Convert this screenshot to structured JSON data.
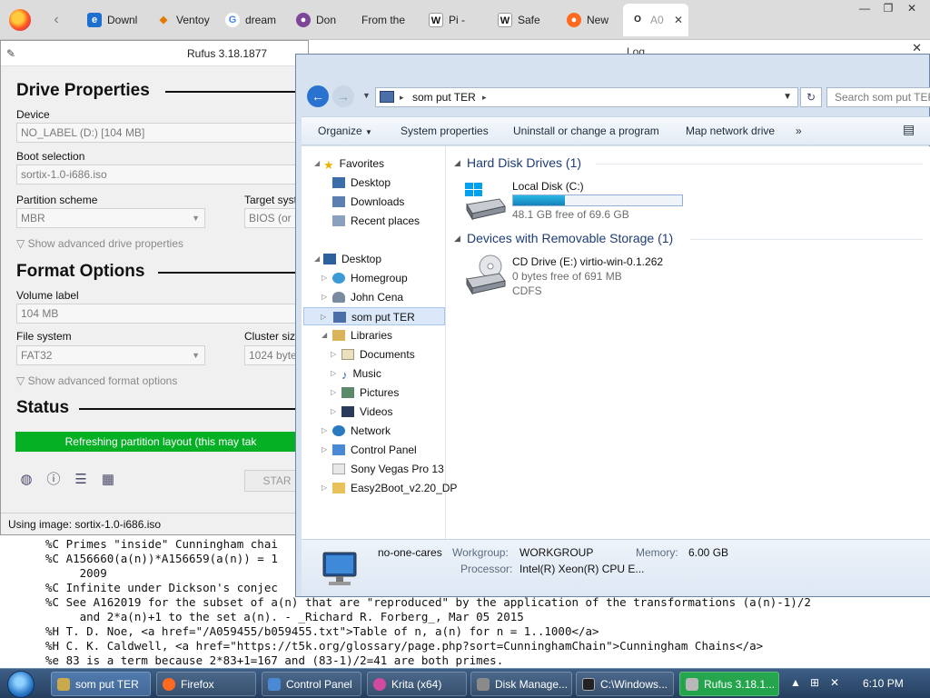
{
  "browser": {
    "tabs": [
      {
        "label": "Downl",
        "icon": "edge-icon"
      },
      {
        "label": "Ventoy",
        "icon": "ventoy-icon"
      },
      {
        "label": "dream",
        "icon": "google-icon"
      },
      {
        "label": "Don",
        "icon": "tor-icon"
      },
      {
        "label": "From the",
        "icon": "blank-icon"
      },
      {
        "label": "Pi -",
        "icon": "wikipedia-icon"
      },
      {
        "label": "Safe",
        "icon": "wikipedia-icon"
      },
      {
        "label": "New",
        "icon": "firefox-icon"
      },
      {
        "label": "A0",
        "icon": "oeis-icon",
        "active": true
      }
    ]
  },
  "rufus": {
    "title": "Rufus 3.18.1877",
    "drive_properties_title": "Drive Properties",
    "device_label": "Device",
    "device_value": "NO_LABEL (D:) [104 MB]",
    "boot_selection_label": "Boot selection",
    "boot_selection_value": "sortix-1.0-i686.iso",
    "partition_scheme_label": "Partition scheme",
    "partition_scheme_value": "MBR",
    "target_system_label": "Target syst",
    "target_system_value": "BIOS (or U",
    "show_advanced_drive": "Show advanced drive properties",
    "format_options_title": "Format Options",
    "volume_label_label": "Volume label",
    "volume_label_value": "104 MB",
    "file_system_label": "File system",
    "file_system_value": "FAT32",
    "cluster_size_label": "Cluster size",
    "cluster_size_value": "1024 bytes",
    "show_advanced_format": "Show advanced format options",
    "status_title": "Status",
    "progress_text": "Refreshing partition layout (this may tak",
    "start_label": "STAR",
    "status_bar": "Using image: sortix-1.0-i686.iso"
  },
  "log_title": "Log",
  "explorer": {
    "address_crumb": "som put TER",
    "search_placeholder": "Search som put TER",
    "toolbar": {
      "organize": "Organize",
      "system_properties": "System properties",
      "uninstall": "Uninstall or change a program",
      "map_drive": "Map network drive",
      "more": "»"
    },
    "nav": {
      "favorites": "Favorites",
      "desktop_fav": "Desktop",
      "downloads": "Downloads",
      "recent_places": "Recent places",
      "desktop": "Desktop",
      "homegroup": "Homegroup",
      "john_cena": "John Cena",
      "som_put_ter": "som put TER",
      "libraries": "Libraries",
      "documents": "Documents",
      "music": "Music",
      "pictures": "Pictures",
      "videos": "Videos",
      "network": "Network",
      "control_panel": "Control Panel",
      "sony_vegas": "Sony Vegas Pro 13",
      "easy2boot": "Easy2Boot_v2.20_DP"
    },
    "hard_disk_header": "Hard Disk Drives (1)",
    "local_disk_name": "Local Disk (C:)",
    "local_disk_free": "48.1 GB free of 69.6 GB",
    "local_disk_used_fraction": 0.309,
    "removable_header": "Devices with Removable Storage (1)",
    "cd_name": "CD Drive (E:) virtio-win-0.1.262",
    "cd_free": "0 bytes free of 691 MB",
    "cd_fs": "CDFS",
    "details": {
      "computer_name": "no-one-cares",
      "workgroup_label": "Workgroup:",
      "workgroup_value": "WORKGROUP",
      "memory_label": "Memory:",
      "memory_value": "6.00 GB",
      "processor_label": "Processor:",
      "processor_value": "Intel(R) Xeon(R) CPU E..."
    }
  },
  "oeis_lines": [
    "%C Primes \"inside\" Cunningham chai",
    "%C A156660(a(n))*A156659(a(n)) = 1",
    "     2009",
    "%C Infinite under Dickson's conjec",
    "%C See A162019 for the subset of a(n) that are \"reproduced\" by the application of the transformations (a(n)-1)/2",
    "     and 2*a(n)+1 to the set a(n). - _Richard R. Forberg_, Mar 05 2015",
    "%H T. D. Noe, <a href=\"/A059455/b059455.txt\">Table of n, a(n) for n = 1..1000</a>",
    "%H C. K. Caldwell, <a href=\"https://t5k.org/glossary/page.php?sort=CunninghamChain\">Cunningham Chains</a>",
    "%e 83 is a term because 2*83+1=167 and (83-1)/2=41 are both primes."
  ],
  "taskbar": {
    "items": [
      {
        "label": "som put TER",
        "color": "#c9a94a"
      },
      {
        "label": "Firefox",
        "color": "#ff6a1f"
      },
      {
        "label": "Control Panel",
        "color": "#4a8ad4"
      },
      {
        "label": "Krita (x64)",
        "color": "#d04aa0"
      },
      {
        "label": "Disk Manage...",
        "color": "#8a8a8a"
      },
      {
        "label": "C:\\Windows...",
        "color": "#222222"
      },
      {
        "label": "Rufus 3.18.1...",
        "color": "#b8b8b8"
      }
    ],
    "clock": "6:10 PM"
  }
}
